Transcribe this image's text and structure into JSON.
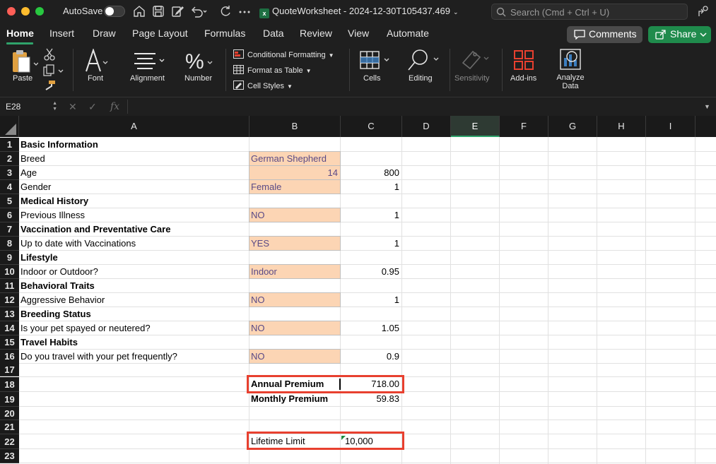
{
  "titlebar": {
    "autosave_label": "AutoSave",
    "document_title": "QuoteWorksheet - 2024-12-30T105437.469",
    "search_placeholder": "Search (Cmd + Ctrl + U)"
  },
  "ribbon_tabs": [
    "Home",
    "Insert",
    "Draw",
    "Page Layout",
    "Formulas",
    "Data",
    "Review",
    "View",
    "Automate"
  ],
  "active_tab": "Home",
  "buttons": {
    "comments": "Comments",
    "share": "Share"
  },
  "ribbon": {
    "paste": "Paste",
    "font": "Font",
    "alignment": "Alignment",
    "number": "Number",
    "conditional_formatting": "Conditional Formatting",
    "format_as_table": "Format as Table",
    "cell_styles": "Cell Styles",
    "cells": "Cells",
    "editing": "Editing",
    "sensitivity": "Sensitivity",
    "add_ins": "Add-ins",
    "analyze_data": "Analyze Data"
  },
  "formula_bar": {
    "name_box": "E28",
    "fx_label": "fx",
    "formula": ""
  },
  "columns": [
    "A",
    "B",
    "C",
    "D",
    "E",
    "F",
    "G",
    "H",
    "I"
  ],
  "selected_column": "E",
  "rows": [
    "1",
    "2",
    "3",
    "4",
    "5",
    "6",
    "7",
    "8",
    "9",
    "10",
    "11",
    "12",
    "13",
    "14",
    "15",
    "16",
    "17",
    "18",
    "19",
    "20",
    "21",
    "22",
    "23"
  ],
  "sheet": {
    "r1": {
      "a": "Basic Information"
    },
    "r2": {
      "a": "Breed",
      "b": "German Shepherd"
    },
    "r3": {
      "a": "Age",
      "b": "14",
      "c": "800"
    },
    "r4": {
      "a": "Gender",
      "b": "Female",
      "c": "1"
    },
    "r5": {
      "a": "Medical History"
    },
    "r6": {
      "a": "Previous Illness",
      "b": "NO",
      "c": "1"
    },
    "r7": {
      "a": "Vaccination and Preventative Care"
    },
    "r8": {
      "a": "Up to date with Vaccinations",
      "b": "YES",
      "c": "1"
    },
    "r9": {
      "a": "Lifestyle"
    },
    "r10": {
      "a": "Indoor or Outdoor?",
      "b": "Indoor",
      "c": "0.95"
    },
    "r11": {
      "a": "Behavioral Traits"
    },
    "r12": {
      "a": "Aggressive Behavior",
      "b": "NO",
      "c": "1"
    },
    "r13": {
      "a": "Breeding Status"
    },
    "r14": {
      "a": "Is your pet spayed or neutered?",
      "b": "NO",
      "c": "1.05"
    },
    "r15": {
      "a": "Travel Habits"
    },
    "r16": {
      "a": "Do you travel with your pet frequently?",
      "b": "NO",
      "c": "0.9"
    },
    "r18": {
      "b": "Annual Premium",
      "c": "718.00"
    },
    "r19": {
      "b": "Monthly Premium",
      "c": "59.83"
    },
    "r22": {
      "b": "Lifetime Limit",
      "c": "10,000"
    }
  },
  "colors": {
    "input_fill": "#fcd5b4",
    "highlight_box": "#e8402f",
    "accent": "#1f8b4c"
  }
}
